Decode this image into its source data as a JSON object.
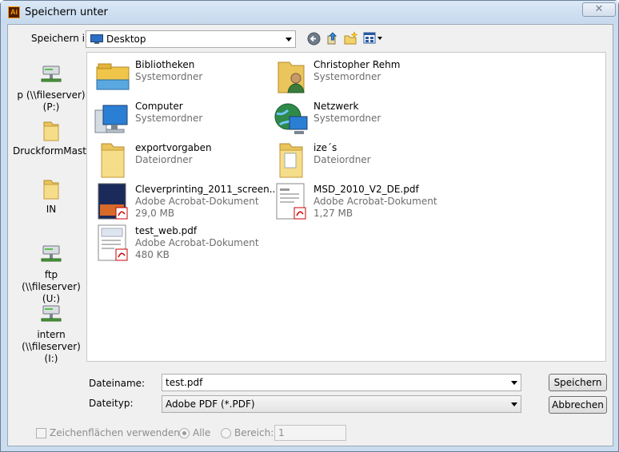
{
  "window": {
    "title": "Speichern unter",
    "app_icon": "Ai",
    "close_glyph": "✕"
  },
  "location": {
    "label": "Speichern in:",
    "value": "Desktop"
  },
  "toolbar_icons": [
    "back-icon",
    "up-folder-icon",
    "new-folder-icon",
    "view-menu-icon"
  ],
  "sidebar": [
    {
      "label": "p (\\\\fileserver) (P:)",
      "icon": "network-drive-icon"
    },
    {
      "label": "DruckformMaster",
      "icon": "folder-icon"
    },
    {
      "label": "IN",
      "icon": "folder-icon"
    },
    {
      "label": "ftp (\\\\fileserver) (U:)",
      "icon": "network-drive-icon"
    },
    {
      "label": "intern (\\\\fileserver) (I:)",
      "icon": "network-drive-icon"
    }
  ],
  "files": [
    {
      "name": "Bibliotheken",
      "type": "Systemordner",
      "size": "",
      "icon": "libraries-icon"
    },
    {
      "name": "Christopher Rehm",
      "type": "Systemordner",
      "size": "",
      "icon": "user-folder-icon"
    },
    {
      "name": "Computer",
      "type": "Systemordner",
      "size": "",
      "icon": "computer-icon"
    },
    {
      "name": "Netzwerk",
      "type": "Systemordner",
      "size": "",
      "icon": "network-icon"
    },
    {
      "name": "exportvorgaben",
      "type": "Dateiordner",
      "size": "",
      "icon": "folder-icon"
    },
    {
      "name": "ize´s",
      "type": "Dateiordner",
      "size": "",
      "icon": "folder-icon"
    },
    {
      "name": "Cleverprinting_2011_screen....",
      "type": "Adobe Acrobat-Dokument",
      "size": "29,0 MB",
      "icon": "pdf-thumbnail-icon"
    },
    {
      "name": "MSD_2010_V2_DE.pdf",
      "type": "Adobe Acrobat-Dokument",
      "size": "1,27 MB",
      "icon": "pdf-thumbnail-icon"
    },
    {
      "name": "test_web.pdf",
      "type": "Adobe Acrobat-Dokument",
      "size": "480 KB",
      "icon": "pdf-thumbnail-icon"
    }
  ],
  "filename": {
    "label": "Dateiname:",
    "value": "test.pdf"
  },
  "filetype": {
    "label": "Dateityp:",
    "value": "Adobe PDF (*.PDF)"
  },
  "buttons": {
    "save": "Speichern",
    "cancel": "Abbrechen"
  },
  "options": {
    "artboards_label": "Zeichenflächen verwenden",
    "all_label": "Alle",
    "range_label": "Bereich:",
    "range_value": "1"
  }
}
